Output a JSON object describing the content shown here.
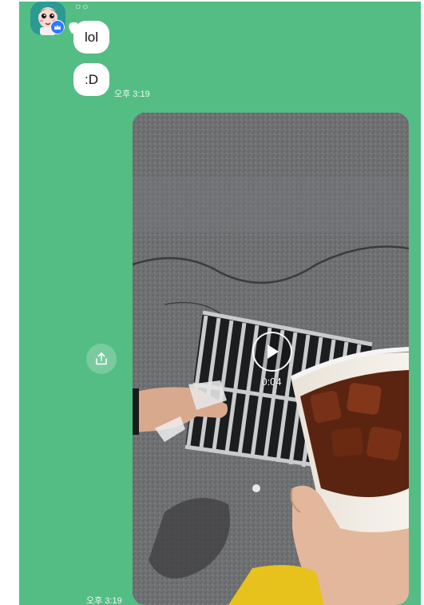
{
  "chat": {
    "sender": {
      "name": "○○"
    },
    "messages": [
      {
        "text": "lol"
      },
      {
        "text": ":D"
      }
    ],
    "text_time": "오후 3:19",
    "video_message": {
      "duration": "0:04",
      "time": "오후 3:19"
    }
  },
  "colors": {
    "chat_background": "#54bd84",
    "bubble": "#ffffff",
    "timestamp": "#e6f6ec"
  },
  "icons": {
    "share": "share-icon",
    "play": "play-icon",
    "badge": "crown-badge-icon"
  }
}
